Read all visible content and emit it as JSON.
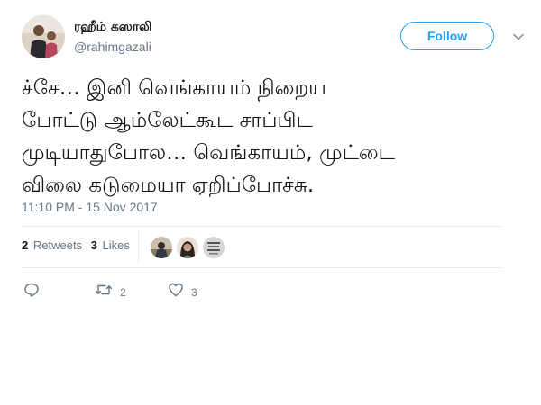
{
  "colors": {
    "accent": "#1da1f2",
    "text": "#14171a",
    "secondary": "#657786",
    "divider": "#e6ecf0"
  },
  "author": {
    "display_name": "ரஹீம் கஸாலி",
    "handle": "@rahimgazali",
    "avatar": "profile-photo"
  },
  "follow_label": "Follow",
  "menu_icon": "chevron-down-icon",
  "tweet": {
    "lines": [
      "ச்சே… இனி வெங்காயம் நிறைய",
      "போட்டு ஆம்லேட்கூட சாப்பிட",
      "முடியாதுபோல… வெங்காயம், முட்டை",
      "விலை கடுமையா ஏறிப்போச்சு."
    ],
    "timestamp": "11:10 PM - 15 Nov 2017"
  },
  "stats": {
    "retweets_count": "2",
    "retweets_label": "Retweets",
    "likes_count": "3",
    "likes_label": "Likes"
  },
  "likers": [
    "liker-avatar-1",
    "liker-avatar-2",
    "liker-avatar-3"
  ],
  "actions": {
    "reply_icon": "reply-icon",
    "retweet_icon": "retweet-icon",
    "retweet_count": "2",
    "like_icon": "heart-icon",
    "like_count": "3"
  }
}
